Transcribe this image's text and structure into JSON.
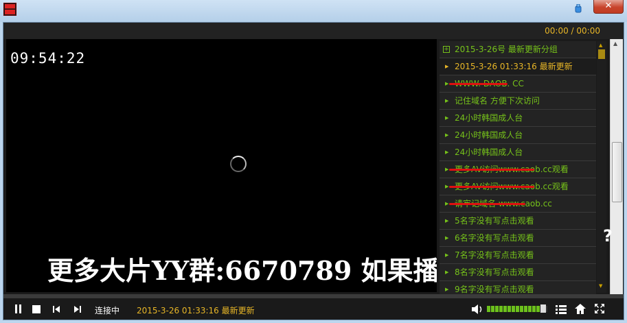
{
  "window": {
    "close_label": "✕"
  },
  "player": {
    "time": "00:00 / 00:00",
    "clock": "09:54:22",
    "overlay": "更多大片YY群:6670789 如果播",
    "overlay_partial": "?",
    "status": "连接中",
    "now_playing": "2015-3-26 01:33:16 最新更新",
    "volume_fraction": 0.9
  },
  "playlist": {
    "items": [
      {
        "label": "2015-3-26号 最新更新分组",
        "type": "group"
      },
      {
        "label": "2015-3-26 01:33:16 最新更新",
        "type": "active"
      },
      {
        "label": "WWW. DAOB. CC",
        "type": "struck"
      },
      {
        "label": "记住域名 方便下次访问",
        "type": "normal"
      },
      {
        "label": "24小时韩国成人台",
        "type": "normal"
      },
      {
        "label": "24小时韩国成人台",
        "type": "normal"
      },
      {
        "label": "24小时韩国成人台",
        "type": "normal"
      },
      {
        "label": "更多AV访问www.caob.cc观看",
        "type": "struck"
      },
      {
        "label": "更多AV访问www.caob.cc观看",
        "type": "struck"
      },
      {
        "label": "请牢记域名 www.caob.cc",
        "type": "struck"
      },
      {
        "label": "5名字没有写点击观看",
        "type": "normal"
      },
      {
        "label": "6名字没有写点击观看",
        "type": "normal"
      },
      {
        "label": "7名字没有写点击观看",
        "type": "normal"
      },
      {
        "label": "8名字没有写点击观看",
        "type": "normal"
      },
      {
        "label": "9名字没有写点击观看",
        "type": "normal"
      }
    ]
  },
  "icons": [
    "app-icon",
    "pin-icon",
    "close-icon",
    "play-pause-icon",
    "stop-icon",
    "prev-icon",
    "next-icon",
    "volume-icon",
    "playlist-icon",
    "home-icon",
    "fullscreen-icon"
  ]
}
